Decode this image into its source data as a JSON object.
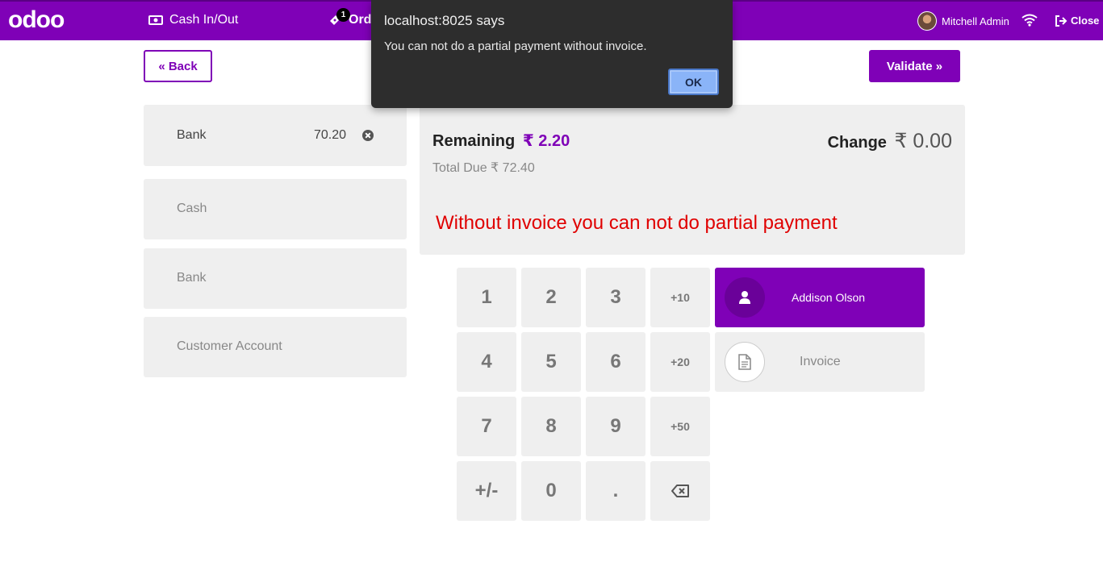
{
  "topbar": {
    "logo": "odoo",
    "cash_in_out": "Cash In/Out",
    "orders_label": "Orders",
    "orders_badge": "1",
    "user_name": "Mitchell Admin",
    "close_label": "Close",
    "brand_color": "#7f01b7"
  },
  "actions": {
    "back_label": "« Back",
    "validate_label": "Validate »"
  },
  "payment_lines": [
    {
      "name": "Bank",
      "amount": "70.20"
    }
  ],
  "payment_methods": [
    "Cash",
    "Bank",
    "Customer Account"
  ],
  "summary": {
    "remaining_label": "Remaining",
    "remaining_amount": "₹ 2.20",
    "total_due_label": "Total Due",
    "total_due_amount": "₹ 72.40",
    "change_label": "Change",
    "change_amount": "₹ 0.00",
    "warning": "Without invoice you can not do partial payment"
  },
  "numpad": {
    "k1": "1",
    "k2": "2",
    "k3": "3",
    "p10": "+10",
    "k4": "4",
    "k5": "5",
    "k6": "6",
    "p20": "+20",
    "k7": "7",
    "k8": "8",
    "k9": "9",
    "p50": "+50",
    "sign": "+/-",
    "k0": "0",
    "dot": "."
  },
  "customer": {
    "name": "Addison Olson"
  },
  "invoice": {
    "label": "Invoice"
  },
  "dialog": {
    "title": "localhost:8025 says",
    "message": "You can not do a partial payment without invoice.",
    "ok_label": "OK"
  }
}
